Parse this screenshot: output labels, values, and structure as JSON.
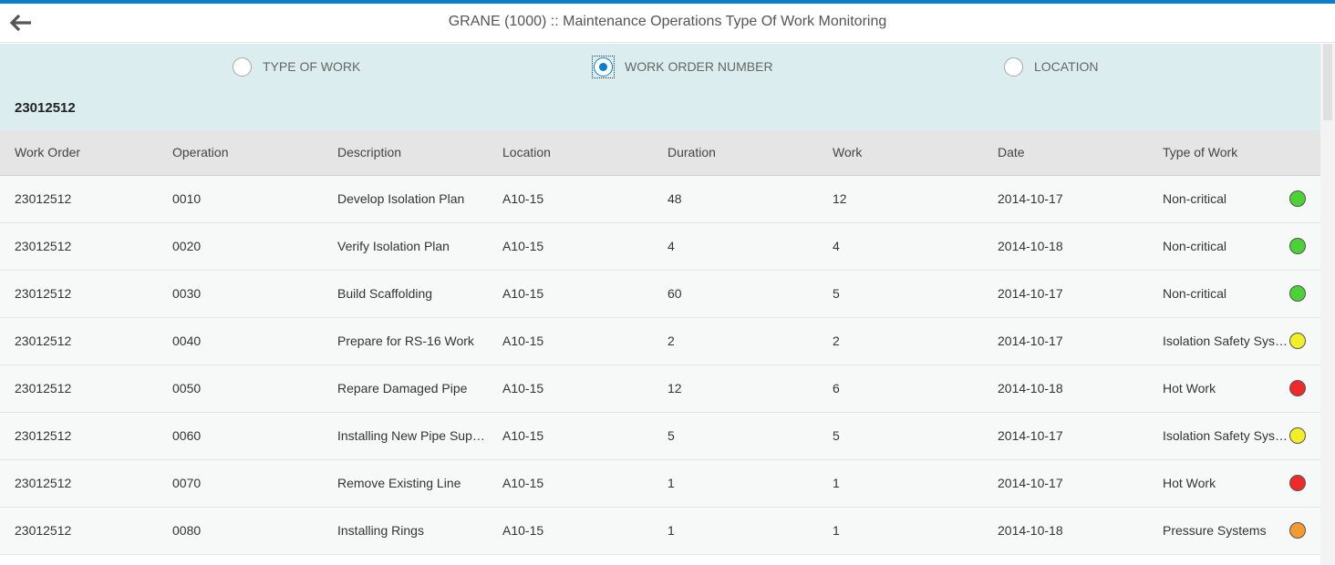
{
  "header": {
    "title": "GRANE (1000) :: Maintenance Operations Type Of Work Monitoring",
    "back_icon": "arrow-left-icon"
  },
  "filter": {
    "options": [
      {
        "label": "TYPE OF WORK",
        "selected": false
      },
      {
        "label": "WORK ORDER NUMBER",
        "selected": true
      },
      {
        "label": "LOCATION",
        "selected": false
      }
    ],
    "selected_value": "23012512"
  },
  "table": {
    "columns": [
      "Work Order",
      "Operation",
      "Description",
      "Location",
      "Duration",
      "Work",
      "Date",
      "Type of Work"
    ],
    "rows": [
      {
        "work_order": "23012512",
        "operation": "0010",
        "description": "Develop Isolation Plan",
        "location": "A10-15",
        "duration": "48",
        "work": "12",
        "date": "2014-10-17",
        "type": "Non-critical",
        "status_color": "#4cd136"
      },
      {
        "work_order": "23012512",
        "operation": "0020",
        "description": "Verify Isolation Plan",
        "location": "A10-15",
        "duration": "4",
        "work": "4",
        "date": "2014-10-18",
        "type": "Non-critical",
        "status_color": "#4cd136"
      },
      {
        "work_order": "23012512",
        "operation": "0030",
        "description": "Build Scaffolding",
        "location": "A10-15",
        "duration": "60",
        "work": "5",
        "date": "2014-10-17",
        "type": "Non-critical",
        "status_color": "#4cd136"
      },
      {
        "work_order": "23012512",
        "operation": "0040",
        "description": "Prepare for RS-16 Work",
        "location": "A10-15",
        "duration": "2",
        "work": "2",
        "date": "2014-10-17",
        "type": "Isolation Safety Systems",
        "status_color": "#f2ee2a"
      },
      {
        "work_order": "23012512",
        "operation": "0050",
        "description": "Repare Damaged Pipe",
        "location": "A10-15",
        "duration": "12",
        "work": "6",
        "date": "2014-10-18",
        "type": "Hot Work",
        "status_color": "#ee2a2a"
      },
      {
        "work_order": "23012512",
        "operation": "0060",
        "description": "Installing New Pipe Supports",
        "location": "A10-15",
        "duration": "5",
        "work": "5",
        "date": "2014-10-17",
        "type": "Isolation Safety Systems",
        "status_color": "#f2ee2a"
      },
      {
        "work_order": "23012512",
        "operation": "0070",
        "description": "Remove Existing Line",
        "location": "A10-15",
        "duration": "1",
        "work": "1",
        "date": "2014-10-17",
        "type": "Hot Work",
        "status_color": "#ee2a2a"
      },
      {
        "work_order": "23012512",
        "operation": "0080",
        "description": "Installing Rings",
        "location": "A10-15",
        "duration": "1",
        "work": "1",
        "date": "2014-10-18",
        "type": "Pressure Systems",
        "status_color": "#f39a32"
      }
    ]
  },
  "colors": {
    "accent": "#0a7fc8",
    "filter_background": "#dcedf0",
    "header_row": "#e5e5e5"
  }
}
